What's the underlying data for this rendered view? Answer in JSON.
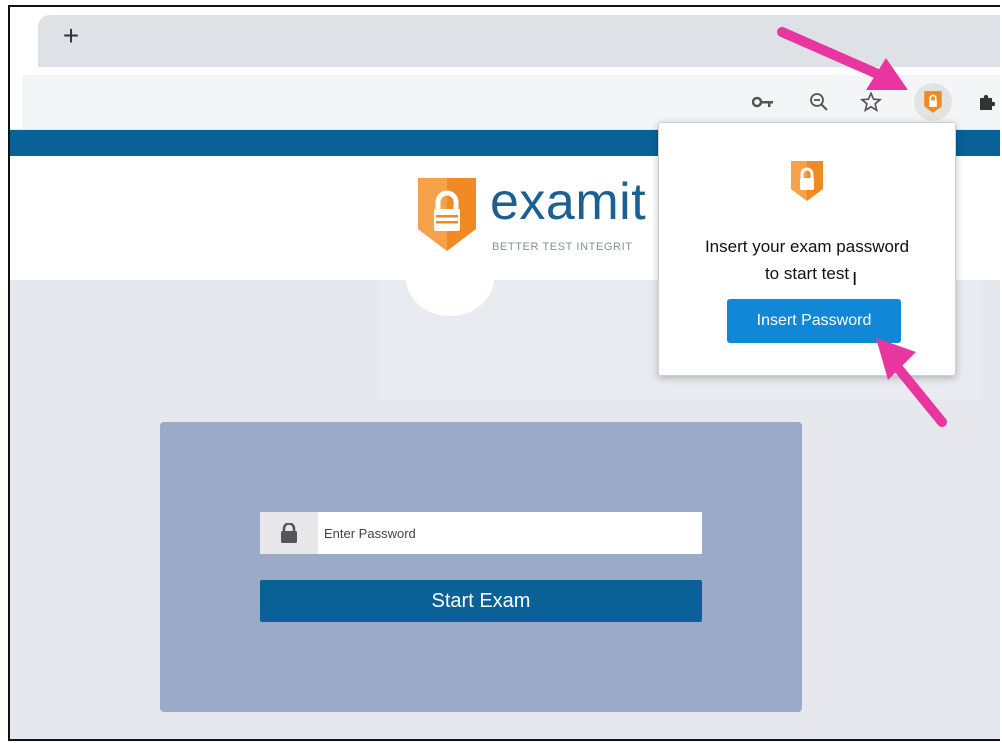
{
  "browser": {
    "new_tab_glyph": "+",
    "toolbar_icons": [
      "key-icon",
      "zoom-out-icon",
      "star-icon",
      "examity-extension-icon",
      "puzzle-extensions-icon"
    ]
  },
  "page": {
    "brand_name": "examit",
    "tagline": "BETTER TEST INTEGRIT",
    "password_placeholder": "Enter Password",
    "start_button": "Start Exam"
  },
  "popup": {
    "message_line1": "Insert your exam password",
    "message_line2": "to start test",
    "button_label": "Insert Password"
  },
  "colors": {
    "brand_blue": "#0a6197",
    "badge_orange": "#f08a24",
    "popup_button": "#1187d8",
    "card_bg": "#9caac9",
    "annotation_arrow": "#e8359f"
  }
}
